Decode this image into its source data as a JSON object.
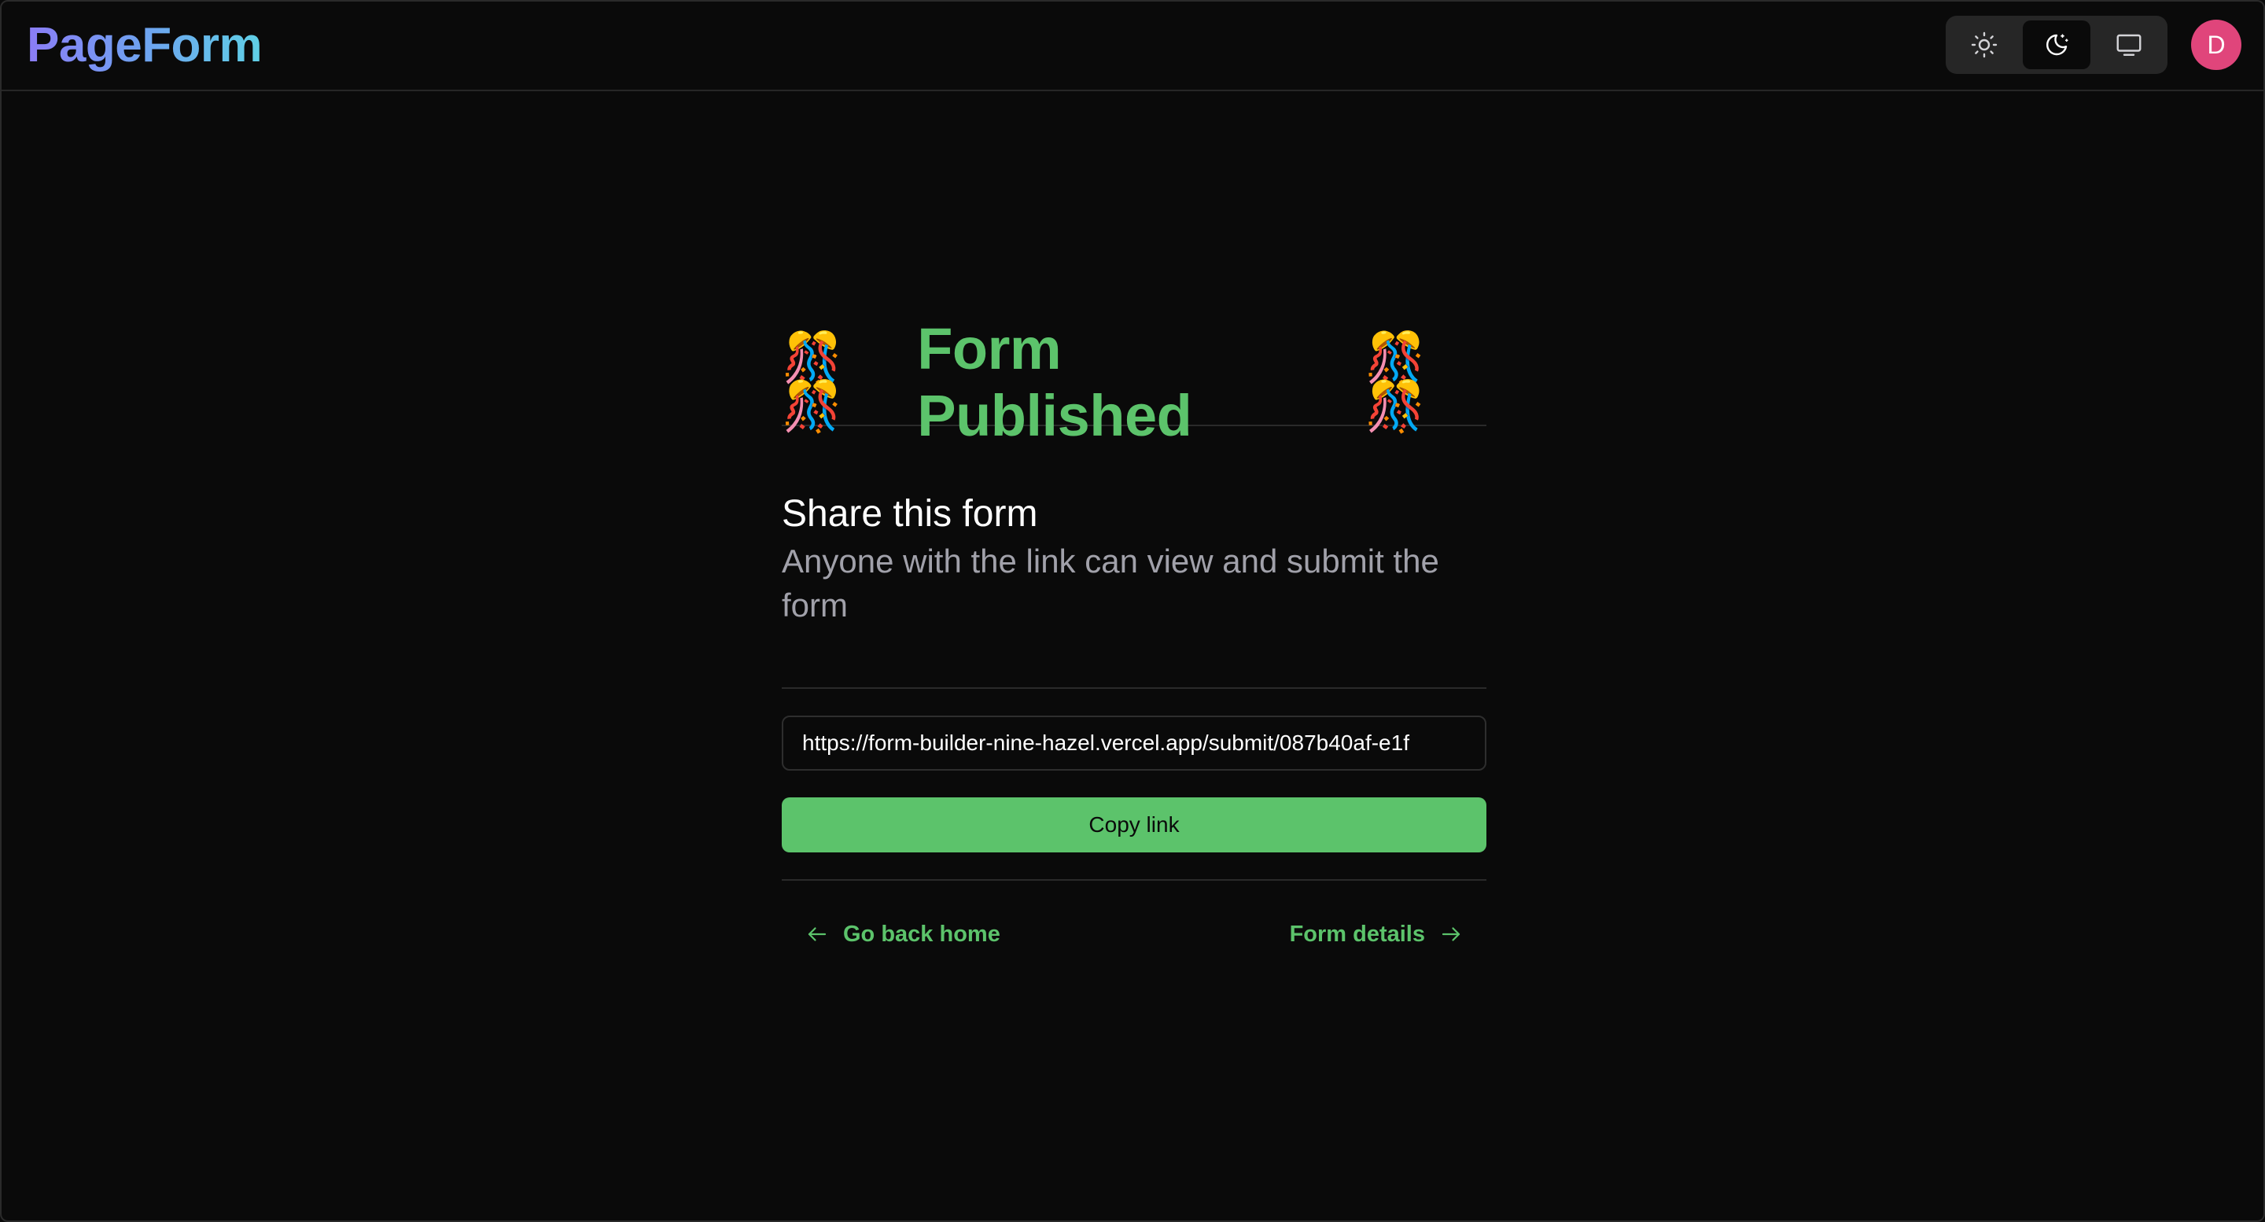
{
  "header": {
    "logo": "PageForm",
    "theme_options": [
      {
        "name": "light",
        "icon": "sun-icon",
        "active": false
      },
      {
        "name": "dark",
        "icon": "moon-icon",
        "active": true
      },
      {
        "name": "system",
        "icon": "monitor-icon",
        "active": false
      }
    ],
    "avatar_initial": "D",
    "avatar_color": "#e0457b"
  },
  "main": {
    "confetti_left": "🎊🎊",
    "title": "Form Published",
    "confetti_right": "🎊🎊",
    "share_title": "Share this form",
    "share_description": "Anyone with the link can view and submit the form",
    "share_link": "https://form-builder-nine-hazel.vercel.app/submit/087b40af-e1f",
    "copy_button_label": "Copy link",
    "back_link_label": "Go back home",
    "details_link_label": "Form details"
  },
  "colors": {
    "accent": "#5cc36b",
    "background": "#0a0a0a",
    "muted_text": "#a1a1aa"
  }
}
